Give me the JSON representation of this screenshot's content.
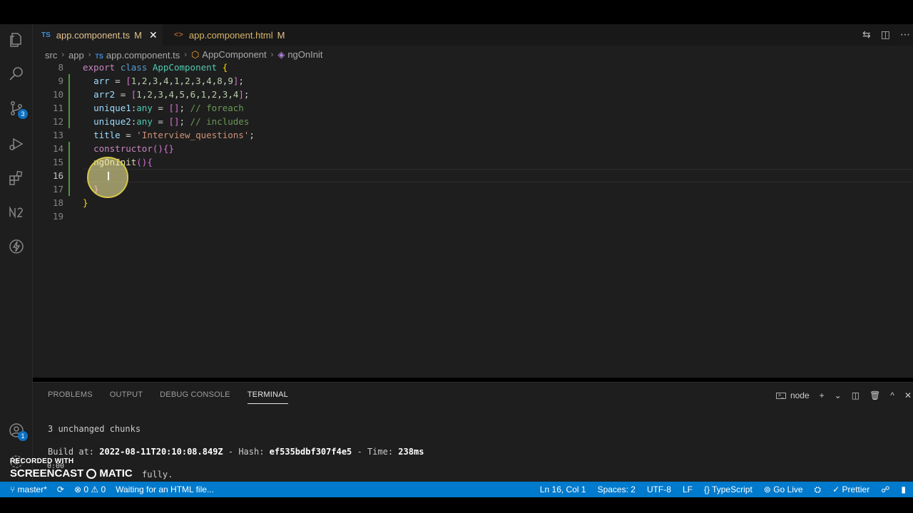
{
  "tabs": [
    {
      "icon": "typescript-icon",
      "mark": "TS",
      "label": "app.component.ts",
      "status": "M",
      "active": true
    },
    {
      "icon": "html-icon",
      "mark": "<>",
      "label": "app.component.html",
      "status": "M",
      "active": false
    }
  ],
  "tab_actions": {
    "compare": "⇆",
    "split": "◫",
    "more": "⋯"
  },
  "breadcrumb": {
    "parts": [
      "src",
      "app",
      "app.component.ts",
      "AppComponent",
      "ngOnInit"
    ],
    "ts_mark": "TS"
  },
  "editor": {
    "lines": [
      "8",
      "9",
      "10",
      "11",
      "12",
      "13",
      "14",
      "15",
      "16",
      "17",
      "18",
      "19"
    ],
    "current_line": "16"
  },
  "activity": {
    "scm_badge": "3",
    "account_badge": "1"
  },
  "panel": {
    "tabs": [
      "PROBLEMS",
      "OUTPUT",
      "DEBUG CONSOLE",
      "TERMINAL"
    ],
    "active_tab": "TERMINAL",
    "terminal_name": "node",
    "terminal_lines": {
      "chunks": "3 unchanged chunks",
      "build_prefix": "Build at: ",
      "build_date": "2022-08-11T20:10:08.849Z",
      "hash_prefix": " - Hash: ",
      "hash": "ef535bdbf307f4e5",
      "time_prefix": " - Time: ",
      "time": "238ms",
      "success": "fully."
    }
  },
  "statusbar": {
    "branch": "master*",
    "sync": "⟳",
    "errors": "⊗ 0",
    "warnings": "⚠ 0",
    "message": "Waiting for an HTML file...",
    "position": "Ln 16, Col 1",
    "spaces": "Spaces: 2",
    "encoding": "UTF-8",
    "eol": "LF",
    "language": "TypeScript",
    "golive": "Go Live",
    "prettier": "Prettier"
  },
  "watermark": {
    "line1": "RECORDED WITH",
    "line2a": "SCREENCAST",
    "line2b": "MATIC",
    "timer": "0:00"
  }
}
